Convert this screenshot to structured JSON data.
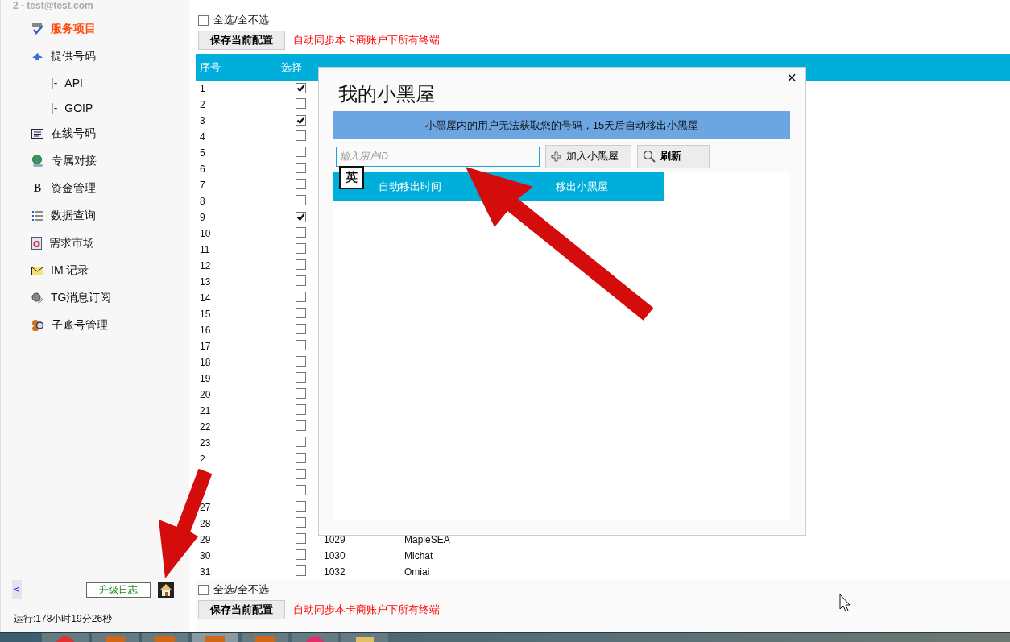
{
  "sidebar": {
    "account": "2 - test@test.com",
    "items": [
      {
        "label": "服务项目",
        "selected": true
      },
      {
        "label": "提供号码",
        "selected": false,
        "children": [
          {
            "prefix": "|-",
            "label": "API",
            "selected": false
          },
          {
            "prefix": "|-",
            "label": "GOIP",
            "selected": false
          }
        ]
      },
      {
        "label": "在线号码",
        "selected": false
      },
      {
        "label": "专属对接",
        "selected": false
      },
      {
        "label": "资金管理",
        "selected": false,
        "icon_glyph": "B"
      },
      {
        "label": "数据查询",
        "selected": false
      },
      {
        "label": "需求市场",
        "selected": false
      },
      {
        "label": "IM 记录",
        "selected": false
      },
      {
        "label": "TG消息订阅",
        "selected": false
      },
      {
        "label": "子账号管理",
        "selected": false
      }
    ],
    "collapse_button": "<",
    "log_button": "升级日志",
    "uptime": "运行:178小时19分26秒"
  },
  "top_bar": {
    "select_all": {
      "label": "全选/全不选",
      "checked": false
    },
    "save_button": "保存当前配置",
    "note": "自动同步本卡商账户下所有终端"
  },
  "table": {
    "columns": [
      "序号",
      "选择"
    ],
    "rows": [
      {
        "index": "1",
        "checked": true
      },
      {
        "index": "2",
        "checked": false
      },
      {
        "index": "3",
        "checked": true
      },
      {
        "index": "4",
        "checked": false
      },
      {
        "index": "5",
        "checked": false
      },
      {
        "index": "6",
        "checked": false
      },
      {
        "index": "7",
        "checked": false
      },
      {
        "index": "8",
        "checked": false
      },
      {
        "index": "9",
        "checked": true
      },
      {
        "index": "10",
        "checked": false
      },
      {
        "index": "11",
        "checked": false
      },
      {
        "index": "12",
        "checked": false
      },
      {
        "index": "13",
        "checked": false
      },
      {
        "index": "14",
        "checked": false
      },
      {
        "index": "15",
        "checked": false
      },
      {
        "index": "16",
        "checked": false
      },
      {
        "index": "17",
        "checked": false
      },
      {
        "index": "18",
        "checked": false
      },
      {
        "index": "19",
        "checked": false
      },
      {
        "index": "20",
        "checked": false
      },
      {
        "index": "21",
        "checked": false
      },
      {
        "index": "22",
        "checked": false
      },
      {
        "index": "23",
        "checked": false
      },
      {
        "index": "2",
        "checked": false
      },
      {
        "checked": false
      },
      {
        "checked": false
      },
      {
        "index": "27",
        "checked": false
      },
      {
        "index": "28",
        "checked": false
      },
      {
        "index": "29",
        "checked": false,
        "column_3": "1029",
        "column_4": "MapleSEA"
      },
      {
        "index": "30",
        "checked": false,
        "column_3": "1030",
        "column_4": "Michat"
      },
      {
        "index": "31",
        "checked": false,
        "column_3": "1032",
        "column_4": "Omiai"
      }
    ]
  },
  "bottom_bar": {
    "select_all": {
      "label": "全选/全不选",
      "checked": false
    },
    "save_button": "保存当前配置",
    "note": "自动同步本卡商账户下所有终端"
  },
  "dialog": {
    "title": "我的小黑屋",
    "close": "×",
    "notice": "小黑屋内的用户无法获取您的号码，15天后自动移出小黑屋",
    "input": {
      "placeholder": "输入用户ID"
    },
    "ime_badge": "英",
    "add_button": "加入小黑屋",
    "refresh_button": "刷新",
    "columns": [
      "自动移出时间",
      "移出小黑屋"
    ]
  }
}
